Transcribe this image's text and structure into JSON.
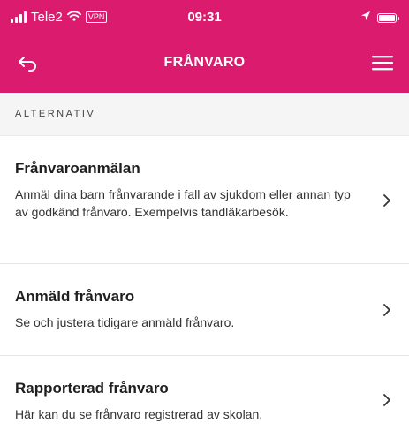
{
  "status_bar": {
    "carrier": "Tele2",
    "vpn": "VPN",
    "time": "09:31"
  },
  "nav": {
    "title": "FRÅNVARO",
    "back_icon": "back-arrow-icon",
    "menu_icon": "hamburger-menu-icon"
  },
  "section": {
    "header": "ALTERNATIV"
  },
  "items": [
    {
      "title": "Frånvaroanmälan",
      "description": "Anmäl dina barn frånvarande i fall av sjukdom eller annan typ av godkänd frånvaro. Exempelvis tandläkarbesök."
    },
    {
      "title": "Anmäld frånvaro",
      "description": "Se och justera tidigare anmäld frånvaro."
    },
    {
      "title": "Rapporterad frånvaro",
      "description": "Här kan du se frånvaro registrerad av skolan."
    }
  ],
  "colors": {
    "accent": "#db1b6e"
  }
}
